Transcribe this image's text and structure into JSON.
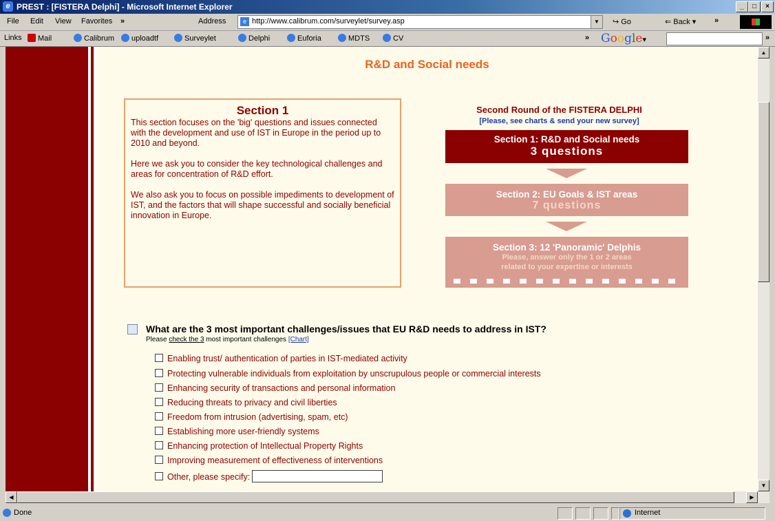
{
  "window": {
    "title": "PREST : [FISTERA Delphi] - Microsoft Internet Explorer"
  },
  "menu": [
    "File",
    "Edit",
    "View",
    "Favorites",
    "»"
  ],
  "address": {
    "label": "Address",
    "url": "http://www.calibrum.com/surveylet/survey.asp",
    "go": "Go",
    "back": "Back",
    "more": "»"
  },
  "links": {
    "label": "Links",
    "items": [
      "Mail",
      "Calibrum",
      "uploadtf",
      "Surveylet",
      "Delphi",
      "Euforia",
      "MDTS",
      "CV"
    ],
    "more": "»"
  },
  "google": {
    "g1": "G",
    "g2": "o",
    "g3": "o",
    "g4": "g",
    "g5": "l",
    "g6": "e",
    "arrow": "▾"
  },
  "page": {
    "title": "R&D and Social needs",
    "section": {
      "heading": "Section 1",
      "p1": "This section focuses on the 'big' questions and issues connected with the development and use of IST in Europe in the period up to 2010 and beyond.",
      "p2": "Here we ask you to consider the key technological challenges and areas for concentration of R&D effort.",
      "p3": "We also ask you to focus on possible impediments to development of IST, and the factors that will shape successful and socially beneficial innovation in Europe."
    },
    "round": {
      "title": "Second Round of the FISTERA DELPHI",
      "subtitle": "[Please, see charts & send your new survey]",
      "s1_l1": "Section 1: R&D and Social needs",
      "s1_l2": "3 questions",
      "s2_l1": "Section 2: EU Goals & IST areas",
      "s2_l2": "7 questions",
      "s3_l1": "Section 3: 12 'Panoramic' Delphis",
      "s3_l2": "Please, answer only the 1 or 2 areas",
      "s3_l3": "related to your expertise or interests"
    },
    "question": {
      "text": "What are the 3 most important challenges/issues that EU R&D needs to address in IST?",
      "instr_pre": "Please ",
      "instr_u": "check the 3",
      "instr_post": " most important challenges",
      "chart_link": "[Chart]",
      "options": [
        "Enabling trust/ authentication of parties in IST-mediated activity",
        "Protecting vulnerable individuals from exploitation by unscrupulous people or commercial interests",
        "Enhancing security of transactions and personal information",
        "Reducing threats to privacy and civil liberties",
        "Freedom from intrusion (advertising, spam, etc)",
        "Establishing more user-friendly systems",
        "Enhancing protection of Intellectual Property Rights",
        "Improving measurement of effectiveness of interventions",
        "Other, please specify:"
      ]
    }
  },
  "status": {
    "text": "Done",
    "zone": "Internet"
  }
}
